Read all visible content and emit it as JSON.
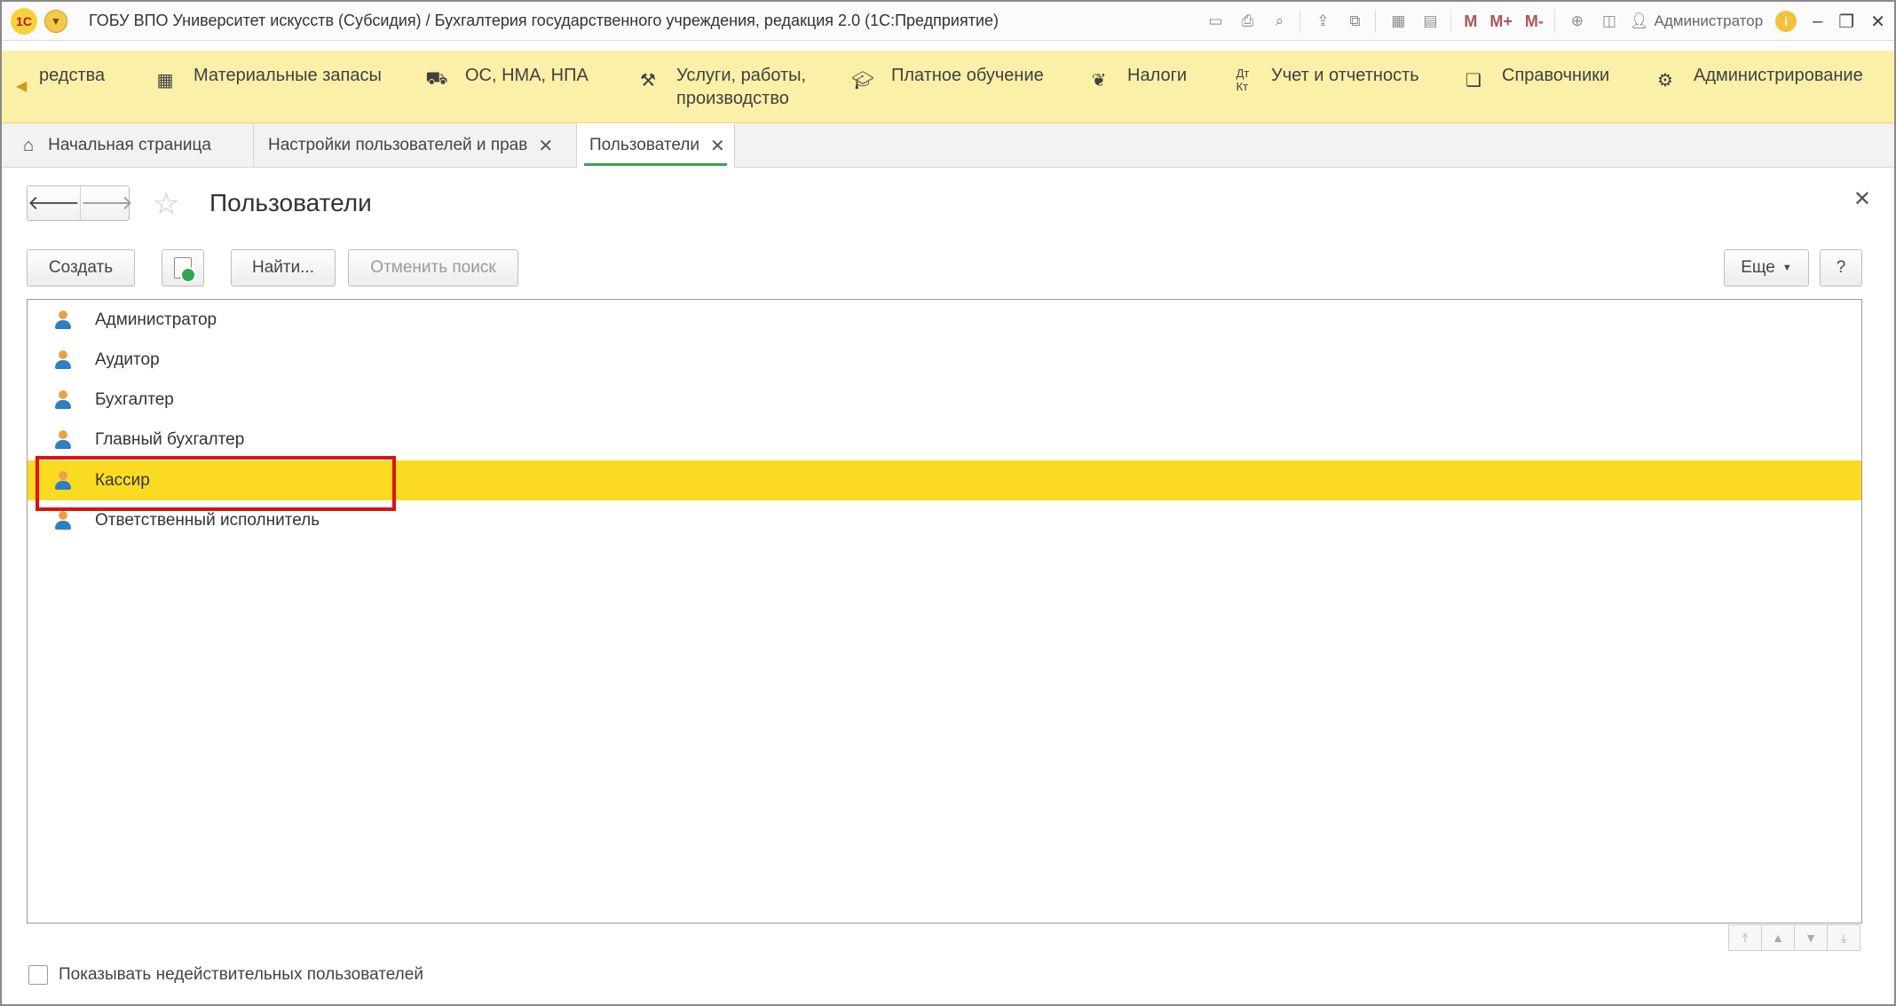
{
  "window": {
    "logo": "1С",
    "title": "ГОБУ ВПО Университет искусств (Субсидия) / Бухгалтерия государственного учреждения, редакция 2.0  (1С:Предприятие)",
    "toolbar_icons": [
      "save-icon",
      "print-icon",
      "preview-icon",
      "upload-icon",
      "compare-icon",
      "calculator-icon",
      "calendar-icon"
    ],
    "memory_buttons": [
      "M",
      "M+",
      "M-"
    ],
    "user": "Администратор"
  },
  "sections": [
    {
      "label": "редства",
      "icon": "wallet-icon"
    },
    {
      "label": "Материальные запасы",
      "icon": "grid-icon"
    },
    {
      "label": "ОС, НМА, НПА",
      "icon": "truck-icon"
    },
    {
      "label": "Услуги, работы, производство",
      "icon": "tools-icon"
    },
    {
      "label": "Платное обучение",
      "icon": "graduation-cap-icon"
    },
    {
      "label": "Налоги",
      "icon": "eagle-icon"
    },
    {
      "label": "Учет и отчетность",
      "icon": "dt-kt-icon"
    },
    {
      "label": "Справочники",
      "icon": "books-icon"
    },
    {
      "label": "Администрирование",
      "icon": "gear-icon"
    }
  ],
  "tabs": [
    {
      "label": "Начальная страница"
    },
    {
      "label": "Настройки пользователей и прав"
    },
    {
      "label": "Пользователи",
      "active": true
    }
  ],
  "form": {
    "title": "Пользователи",
    "buttons": {
      "create": "Создать",
      "find": "Найти...",
      "cancel_search": "Отменить поиск",
      "more": "Еще",
      "help": "?"
    }
  },
  "users": [
    {
      "name": "Администратор"
    },
    {
      "name": "Аудитор"
    },
    {
      "name": "Бухгалтер"
    },
    {
      "name": "Главный бухгалтер"
    },
    {
      "name": "Кассир",
      "selected": true
    },
    {
      "name": "Ответственный исполнитель"
    }
  ],
  "footer": {
    "show_invalid_label": "Показывать недействительных пользователей",
    "show_invalid_checked": false
  },
  "colors": {
    "sections_bg": "#faf0a8",
    "selection": "#fadb22",
    "highlight_box": "#e01010",
    "active_tab_underline": "#3aa05a"
  }
}
